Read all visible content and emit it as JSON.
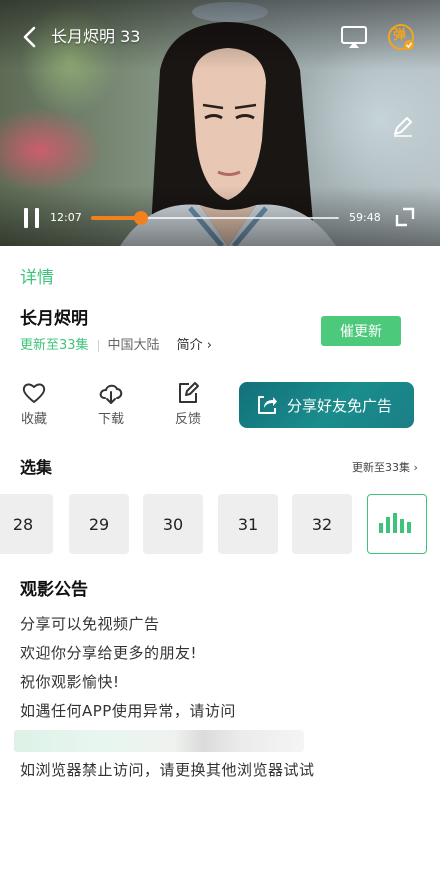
{
  "player": {
    "title": "长月烬明 33",
    "current_time": "12:07",
    "total_time": "59:48",
    "progress": 0.2,
    "accent_color": "#f3801f",
    "danmaku_label": "弹"
  },
  "details": {
    "tab_label": "详情",
    "title": "长月烬明",
    "update_status": "更新至33集",
    "region": "中国大陆",
    "intro_label": "简介 ›",
    "urge_button": "催更新",
    "accent_color": "#3ec47a"
  },
  "actions": [
    {
      "label": "收藏",
      "icon": "heart-icon"
    },
    {
      "label": "下载",
      "icon": "cloud-download-icon"
    },
    {
      "label": "反馈",
      "icon": "feedback-edit-icon"
    }
  ],
  "share": {
    "label": "分享好友免广告",
    "icon": "share-icon"
  },
  "episodes": {
    "heading": "选集",
    "more_label": "更新至33集 ›",
    "items": [
      "28",
      "29",
      "30",
      "31",
      "32"
    ],
    "playing_icon": "playing-equalizer-icon"
  },
  "notice": {
    "title": "观影公告",
    "lines": [
      "分享可以免视频广告",
      "欢迎你分享给更多的朋友!",
      "祝你观影愉快!",
      "如遇任何APP使用异常，请访问",
      "如浏览器禁止访问，请更换其他浏览器试试"
    ]
  }
}
